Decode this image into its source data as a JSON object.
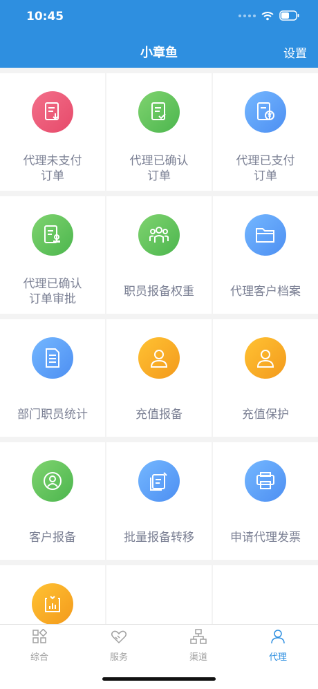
{
  "status": {
    "time": "10:45"
  },
  "header": {
    "title": "小章鱼",
    "settings_label": "设置"
  },
  "tiles": [
    {
      "line1": "代理未支付",
      "line2": "订单",
      "color": "red",
      "icon": "document-download-icon"
    },
    {
      "line1": "代理已确认",
      "line2": "订单",
      "color": "green",
      "icon": "document-check-icon"
    },
    {
      "line1": "代理已支付",
      "line2": "订单",
      "color": "blue",
      "icon": "document-yen-icon"
    },
    {
      "line1": "代理已确认",
      "line2": "订单审批",
      "color": "green",
      "icon": "document-stamp-icon"
    },
    {
      "line1": "职员报备权重",
      "line2": "",
      "color": "green",
      "icon": "people-group-icon"
    },
    {
      "line1": "代理客户档案",
      "line2": "",
      "color": "blue",
      "icon": "folder-icon"
    },
    {
      "line1": "部门职员统计",
      "line2": "",
      "color": "blue",
      "icon": "document-lines-icon"
    },
    {
      "line1": "充值报备",
      "line2": "",
      "color": "orange",
      "icon": "person-icon"
    },
    {
      "line1": "充值保护",
      "line2": "",
      "color": "orange",
      "icon": "person-icon"
    },
    {
      "line1": "客户报备",
      "line2": "",
      "color": "green",
      "icon": "user-circle-icon"
    },
    {
      "line1": "批量报备转移",
      "line2": "",
      "color": "blue",
      "icon": "batch-edit-icon"
    },
    {
      "line1": "申请代理发票",
      "line2": "",
      "color": "blue",
      "icon": "printer-icon"
    },
    {
      "line1": "",
      "line2": "",
      "color": "orange",
      "icon": "chart-report-icon"
    }
  ],
  "nav": [
    {
      "label": "综合",
      "icon": "grid-icon",
      "active": false
    },
    {
      "label": "服务",
      "icon": "handshake-icon",
      "active": false
    },
    {
      "label": "渠道",
      "icon": "network-icon",
      "active": false
    },
    {
      "label": "代理",
      "icon": "person-outline-icon",
      "active": true
    }
  ]
}
